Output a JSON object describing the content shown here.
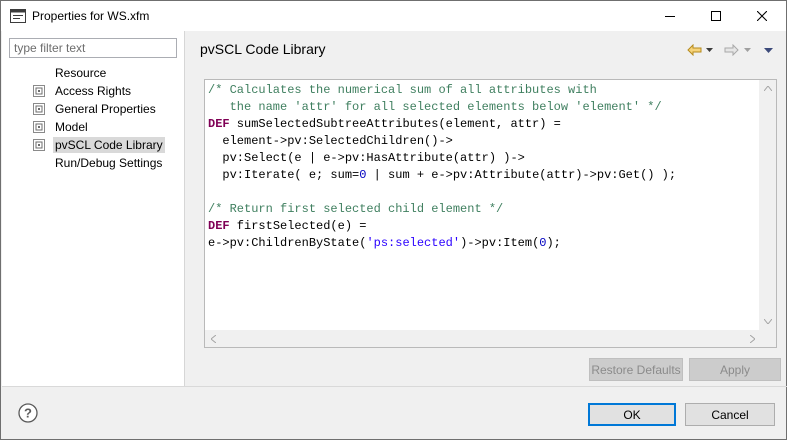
{
  "window": {
    "title": "Properties for WS.xfm"
  },
  "filter": {
    "placeholder": "type filter text",
    "value": ""
  },
  "tree": {
    "items": [
      {
        "label": "Resource",
        "has_icon": false,
        "selected": false
      },
      {
        "label": "Access Rights",
        "has_icon": true,
        "selected": false
      },
      {
        "label": "General Properties",
        "has_icon": true,
        "selected": false
      },
      {
        "label": "Model",
        "has_icon": true,
        "selected": false
      },
      {
        "label": "pvSCL Code Library",
        "has_icon": true,
        "selected": true
      },
      {
        "label": "Run/Debug Settings",
        "has_icon": false,
        "selected": false
      }
    ]
  },
  "page": {
    "title": "pvSCL Code Library"
  },
  "nav": {
    "back_icon": "back-arrow-icon",
    "forward_icon": "forward-arrow-icon",
    "menu_icon": "view-menu-icon"
  },
  "editor": {
    "lines": [
      [
        {
          "t": "/* Calculates the numerical sum of all attributes with",
          "c": "comment"
        }
      ],
      [
        {
          "t": "   the name 'attr' for all selected elements below 'element' */",
          "c": "comment"
        }
      ],
      [
        {
          "t": "DEF",
          "c": "keyword"
        },
        {
          "t": " sumSelectedSubtreeAttributes(element, attr) =",
          "c": ""
        }
      ],
      [
        {
          "t": "  element->pv:SelectedChildren()->",
          "c": ""
        }
      ],
      [
        {
          "t": "  pv:Select(e | e->pv:HasAttribute(attr) )->",
          "c": ""
        }
      ],
      [
        {
          "t": "  pv:Iterate( e; sum=",
          "c": ""
        },
        {
          "t": "0",
          "c": "number"
        },
        {
          "t": " | sum + e->pv:Attribute(attr)->pv:Get() );",
          "c": ""
        }
      ],
      [
        {
          "t": "",
          "c": ""
        }
      ],
      [
        {
          "t": "/* Return first selected child element */",
          "c": "comment"
        }
      ],
      [
        {
          "t": "DEF",
          "c": "keyword"
        },
        {
          "t": " firstSelected(e) =",
          "c": ""
        }
      ],
      [
        {
          "t": "e->pv:ChildrenByState(",
          "c": ""
        },
        {
          "t": "'ps:selected'",
          "c": "string"
        },
        {
          "t": ")->pv:Item(",
          "c": ""
        },
        {
          "t": "0",
          "c": "number"
        },
        {
          "t": ");",
          "c": ""
        }
      ]
    ]
  },
  "buttons": {
    "restore_defaults": "Restore Defaults",
    "apply": "Apply",
    "ok": "OK",
    "cancel": "Cancel"
  },
  "colors": {
    "comment": "#3f7f5f",
    "keyword": "#7f0055",
    "number": "#0000c0",
    "string": "#2a00ff",
    "selection": "#d9d9d9",
    "primary_border": "#0078d7"
  }
}
